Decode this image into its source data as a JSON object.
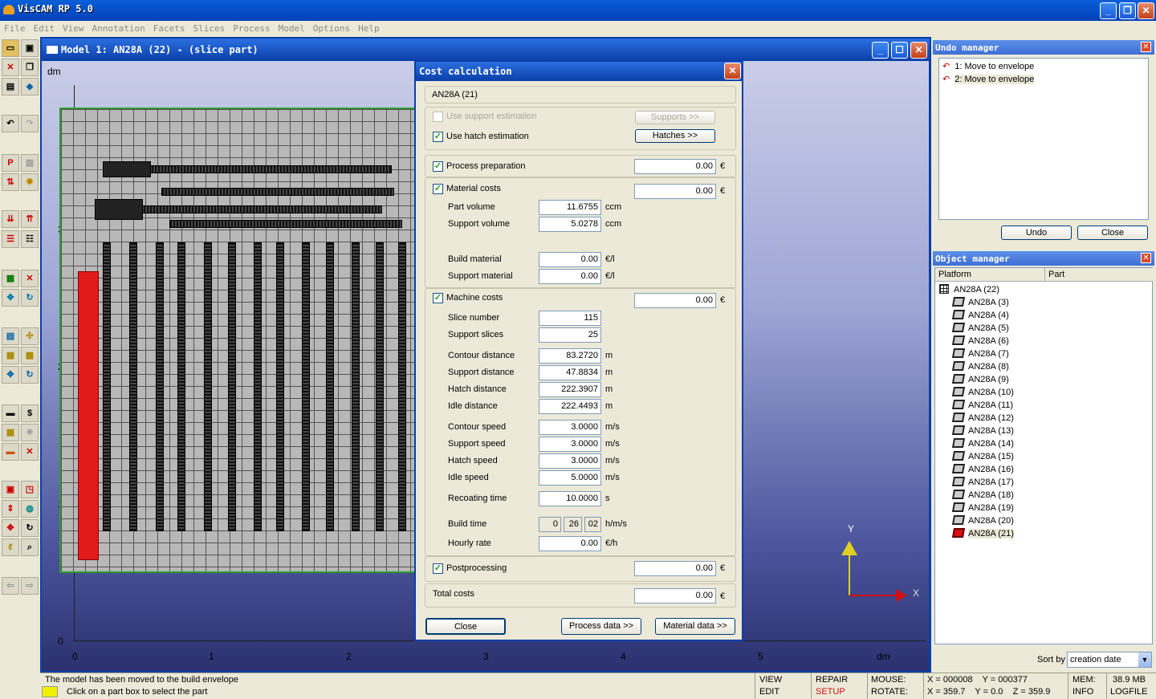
{
  "app": {
    "title": "VisCAM RP 5.0"
  },
  "menu": [
    "File",
    "Edit",
    "View",
    "Annotation",
    "Facets",
    "Slices",
    "Process",
    "Model",
    "Options",
    "Help"
  ],
  "model_window": {
    "title": "Model 1: AN28A (22) - (slice part)"
  },
  "viewport": {
    "unit_label": "dm",
    "x_unit_label": "dm",
    "y_ticks": [
      "3",
      "2",
      "1",
      "0"
    ],
    "x_ticks": [
      "0",
      "1",
      "2",
      "3",
      "4",
      "5"
    ],
    "axis_x": "X",
    "axis_y": "Y"
  },
  "cost": {
    "title": "Cost calculation",
    "part_name": "AN28A (21)",
    "use_support_estimation": "Use support estimation",
    "supports_btn": "Supports >>",
    "use_hatch_estimation": "Use hatch estimation",
    "hatches_btn": "Hatches >>",
    "process_preparation": "Process preparation",
    "process_preparation_value": "0.00",
    "material_costs": "Material costs",
    "material_costs_value": "0.00",
    "part_volume": "Part volume",
    "part_volume_value": "11.6755",
    "part_volume_unit": "ccm",
    "support_volume": "Support volume",
    "support_volume_value": "5.0278",
    "support_volume_unit": "ccm",
    "build_material": "Build material",
    "build_material_value": "0.00",
    "build_material_unit": "€/l",
    "support_material": "Support material",
    "support_material_value": "0.00",
    "support_material_unit": "€/l",
    "machine_costs": "Machine costs",
    "machine_costs_value": "0.00",
    "slice_number": "Slice number",
    "slice_number_value": "115",
    "support_slices": "Support slices",
    "support_slices_value": "25",
    "contour_distance": "Contour distance",
    "contour_distance_value": "83.2720",
    "m": "m",
    "support_distance": "Support distance",
    "support_distance_value": "47.8834",
    "hatch_distance": "Hatch distance",
    "hatch_distance_value": "222.3907",
    "idle_distance": "Idle distance",
    "idle_distance_value": "222.4493",
    "contour_speed": "Contour speed",
    "contour_speed_value": "3.0000",
    "ms": "m/s",
    "support_speed": "Support speed",
    "support_speed_value": "3.0000",
    "hatch_speed": "Hatch speed",
    "hatch_speed_value": "3.0000",
    "idle_speed": "Idle speed",
    "idle_speed_value": "5.0000",
    "recoating_time": "Recoating time",
    "recoating_time_value": "10.0000",
    "s": "s",
    "build_time": "Build time",
    "build_h": "0",
    "build_m": "26",
    "build_s": "02",
    "build_unit": "h/m/s",
    "hourly_rate": "Hourly rate",
    "hourly_rate_value": "0.00",
    "hourly_unit": "€/h",
    "postprocessing": "Postprocessing",
    "postprocessing_value": "0.00",
    "total_costs": "Total costs",
    "total_costs_value": "0.00",
    "euro": "€",
    "close_btn": "Close",
    "process_data_btn": "Process data >>",
    "material_data_btn": "Material data >>"
  },
  "undo": {
    "title": "Undo manager",
    "items": [
      "1: Move to envelope",
      "2: Move to envelope"
    ],
    "undo_btn": "Undo",
    "close_btn": "Close"
  },
  "objects": {
    "title": "Object manager",
    "col1": "Platform",
    "col2": "Part",
    "root": "AN28A (22)",
    "items": [
      "AN28A (3)",
      "AN28A (4)",
      "AN28A (5)",
      "AN28A (6)",
      "AN28A (7)",
      "AN28A (8)",
      "AN28A (9)",
      "AN28A (10)",
      "AN28A (11)",
      "AN28A (12)",
      "AN28A (13)",
      "AN28A (14)",
      "AN28A (15)",
      "AN28A (16)",
      "AN28A (17)",
      "AN28A (18)",
      "AN28A (19)",
      "AN28A (20)",
      "AN28A (21)"
    ],
    "sort_label": "Sort by",
    "sort_value": "creation date"
  },
  "status": {
    "line1": "The model has been moved to the build envelope",
    "line2": "Click on a part box to select the part",
    "view": "VIEW",
    "edit": "EDIT",
    "repair": "REPAIR",
    "setup": "SETUP",
    "mouse": "MOUSE:",
    "rotate": "ROTATE:",
    "mouse_xy": "X = 000008    Y = 000377",
    "rotate_xyz": "X = 359.7    Y = 0.0    Z = 359.9",
    "mem": "MEM:",
    "mem_value": "38.9 MB",
    "info": "INFO",
    "logfile": "LOGFILE",
    "setup_color": "#d01010"
  }
}
